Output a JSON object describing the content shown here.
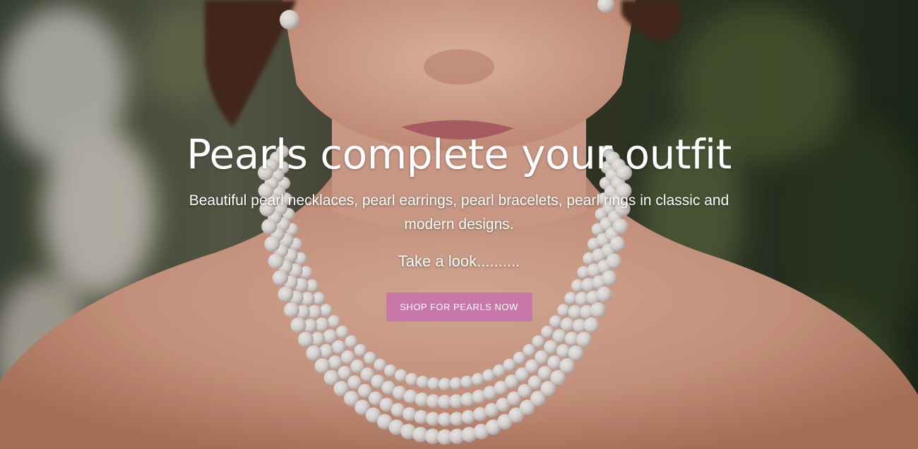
{
  "hero": {
    "background_image": "woman-wearing-multi-strand-pearl-necklace-photo",
    "title": "Pearls complete your outfit",
    "subtitle": "Beautiful pearl necklaces, pearl earrings, pearl bracelets, pearl rings in classic and modern designs.",
    "teaser": "Take a look..........",
    "cta_label": "SHOP FOR PEARLS NOW"
  },
  "colors": {
    "cta_background": "#c778a8",
    "text": "#ffffff"
  }
}
